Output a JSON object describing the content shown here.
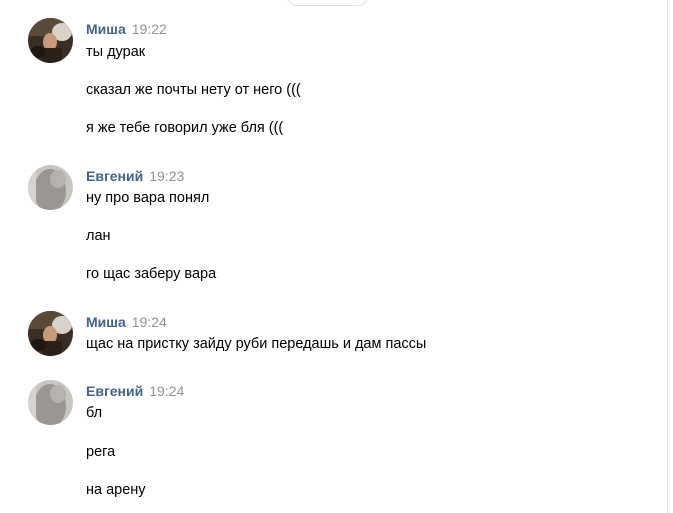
{
  "chat": {
    "groups": [
      {
        "author": "Миша",
        "time": "19:22",
        "avatar": "misha-avatar",
        "messages": [
          "ты дурак",
          "сказал же почты нету от него (((",
          "я же тебе говорил уже бля ((("
        ]
      },
      {
        "author": "Евгений",
        "time": "19:23",
        "avatar": "evgeny-avatar",
        "messages": [
          "ну про вара понял",
          "лан",
          "го щас заберу вара"
        ]
      },
      {
        "author": "Миша",
        "time": "19:24",
        "avatar": "misha-avatar",
        "messages": [
          "щас на пристку зайду руби передашь и дам пассы"
        ]
      },
      {
        "author": "Евгений",
        "time": "19:24",
        "avatar": "evgeny-avatar",
        "messages": [
          "бл",
          "рега",
          "на арену"
        ]
      }
    ]
  },
  "colors": {
    "author": "#42648b",
    "time": "#939393",
    "text": "#000000",
    "background": "#ffffff"
  }
}
